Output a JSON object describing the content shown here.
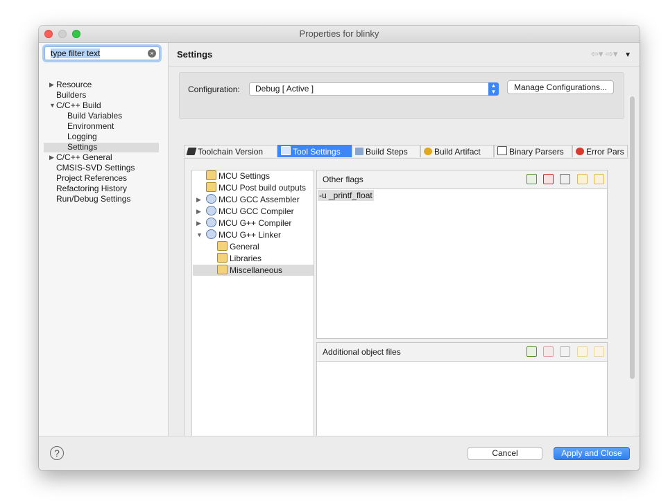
{
  "window": {
    "title": "Properties for blinky"
  },
  "sidebar": {
    "filter_placeholder": "type filter text",
    "items": [
      {
        "label": "Resource",
        "expandable": true
      },
      {
        "label": "Builders"
      },
      {
        "label": "C/C++ Build",
        "expanded": true
      },
      {
        "label": "Build Variables"
      },
      {
        "label": "Environment"
      },
      {
        "label": "Logging"
      },
      {
        "label": "Settings",
        "selected": true
      },
      {
        "label": "C/C++ General",
        "expandable": true
      },
      {
        "label": "CMSIS-SVD Settings"
      },
      {
        "label": "Project References"
      },
      {
        "label": "Refactoring History"
      },
      {
        "label": "Run/Debug Settings"
      }
    ]
  },
  "header": {
    "title": "Settings"
  },
  "config": {
    "label": "Configuration:",
    "selected": "Debug  [ Active ]",
    "manage_label": "Manage Configurations..."
  },
  "tabs": [
    {
      "label": "Toolchain  Version"
    },
    {
      "label": "Tool Settings",
      "active": true
    },
    {
      "label": "Build Steps"
    },
    {
      "label": "Build Artifact"
    },
    {
      "label": "Binary Parsers"
    },
    {
      "label": "Error Pars"
    }
  ],
  "tool_tree": [
    {
      "label": "MCU Settings"
    },
    {
      "label": "MCU Post build outputs"
    },
    {
      "label": "MCU GCC Assembler",
      "expandable": true
    },
    {
      "label": "MCU GCC Compiler",
      "expandable": true
    },
    {
      "label": "MCU G++ Compiler",
      "expandable": true
    },
    {
      "label": "MCU G++ Linker",
      "expanded": true
    },
    {
      "label": "General"
    },
    {
      "label": "Libraries"
    },
    {
      "label": "Miscellaneous",
      "selected": true
    }
  ],
  "other_flags": {
    "title": "Other flags",
    "values": [
      "-u _printf_float"
    ]
  },
  "additional_objects": {
    "title": "Additional object files",
    "values": []
  },
  "buttons": {
    "cancel": "Cancel",
    "apply": "Apply and Close"
  },
  "colors": {
    "accent": "#3a87f5",
    "window_bg": "#ececec"
  },
  "icons": {
    "help": "?",
    "clear": "×",
    "arrow_right": "▶",
    "arrow_down": "▼",
    "chev": "⌃⌄"
  }
}
